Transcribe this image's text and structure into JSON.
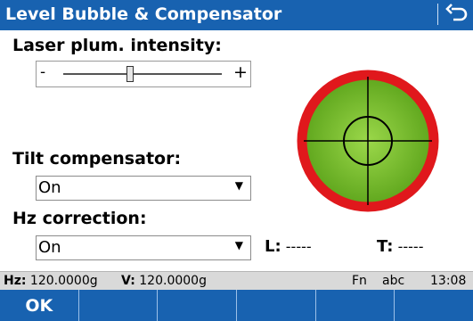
{
  "window": {
    "title": "Level Bubble & Compensator"
  },
  "laser": {
    "label": "Laser plum. intensity:",
    "minus": "-",
    "plus": "+",
    "intensity_fraction": 0.42
  },
  "tilt": {
    "label": "Tilt compensator:",
    "value": "On"
  },
  "hz": {
    "label": "Hz correction:",
    "value": "On"
  },
  "tilt_readout": {
    "l_label": "L:",
    "l_value": "-----",
    "t_label": "T:",
    "t_value": "-----"
  },
  "status": {
    "hz_label": "Hz:",
    "hz_value": "120.0000g",
    "v_label": "V:",
    "v_value": "120.0000g",
    "fn": "Fn",
    "mode": "abc",
    "time": "13:08"
  },
  "softkeys": [
    "OK",
    "",
    "",
    "",
    "",
    ""
  ],
  "colors": {
    "bar": "#1862b0",
    "bubble_ring": "#e0181c",
    "bubble_fill": "#7cc32a"
  },
  "icons": {
    "back": "back-arrow-icon",
    "dropdown": "dropdown-arrow-icon"
  }
}
